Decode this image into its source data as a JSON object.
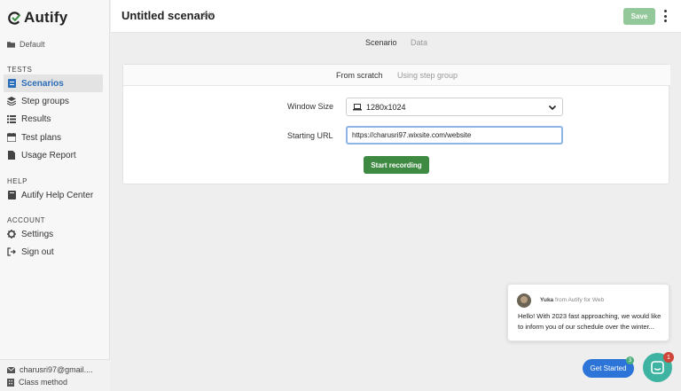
{
  "app": {
    "name": "Autify"
  },
  "sidebar": {
    "project": "Default",
    "sections": {
      "tests": "TESTS",
      "help": "HELP",
      "account": "ACCOUNT"
    },
    "items": [
      {
        "label": "Scenarios",
        "icon": "document-icon",
        "active": true
      },
      {
        "label": "Step groups",
        "icon": "layers-icon"
      },
      {
        "label": "Results",
        "icon": "list-icon"
      },
      {
        "label": "Test plans",
        "icon": "calendar-icon"
      },
      {
        "label": "Usage Report",
        "icon": "report-icon"
      },
      {
        "label": "Autify Help Center",
        "icon": "book-icon"
      },
      {
        "label": "Settings",
        "icon": "gear-icon"
      },
      {
        "label": "Sign out",
        "icon": "sign-out-icon"
      }
    ],
    "user": {
      "email": "charusri97@gmail....",
      "plan": "Class method"
    }
  },
  "header": {
    "title": "Untitled scenario",
    "edit_label": "Edit",
    "save_label": "Save"
  },
  "tabs": {
    "scenario": "Scenario",
    "data": "Data"
  },
  "card": {
    "tabs": {
      "scratch": "From scratch",
      "step_group": "Using step group"
    },
    "window_size_label": "Window Size",
    "window_size_value": "1280x1024",
    "starting_url_label": "Starting URL",
    "starting_url_value": "https://charusri97.wixsite.com/website",
    "record_label": "Start recording"
  },
  "chat": {
    "sender_name": "Yuka",
    "sender_suffix": "from Autify for Web",
    "message": "Hello! With 2023 fast approaching, we would like to inform you of our schedule over the winter...",
    "get_started": "Get Started",
    "get_started_badge": "3",
    "unread_count": "1"
  },
  "colors": {
    "accent_blue": "#2a6db8",
    "save_green": "#93c89a",
    "record_green": "#3e8a43",
    "chat_teal": "#3fb3a2"
  }
}
